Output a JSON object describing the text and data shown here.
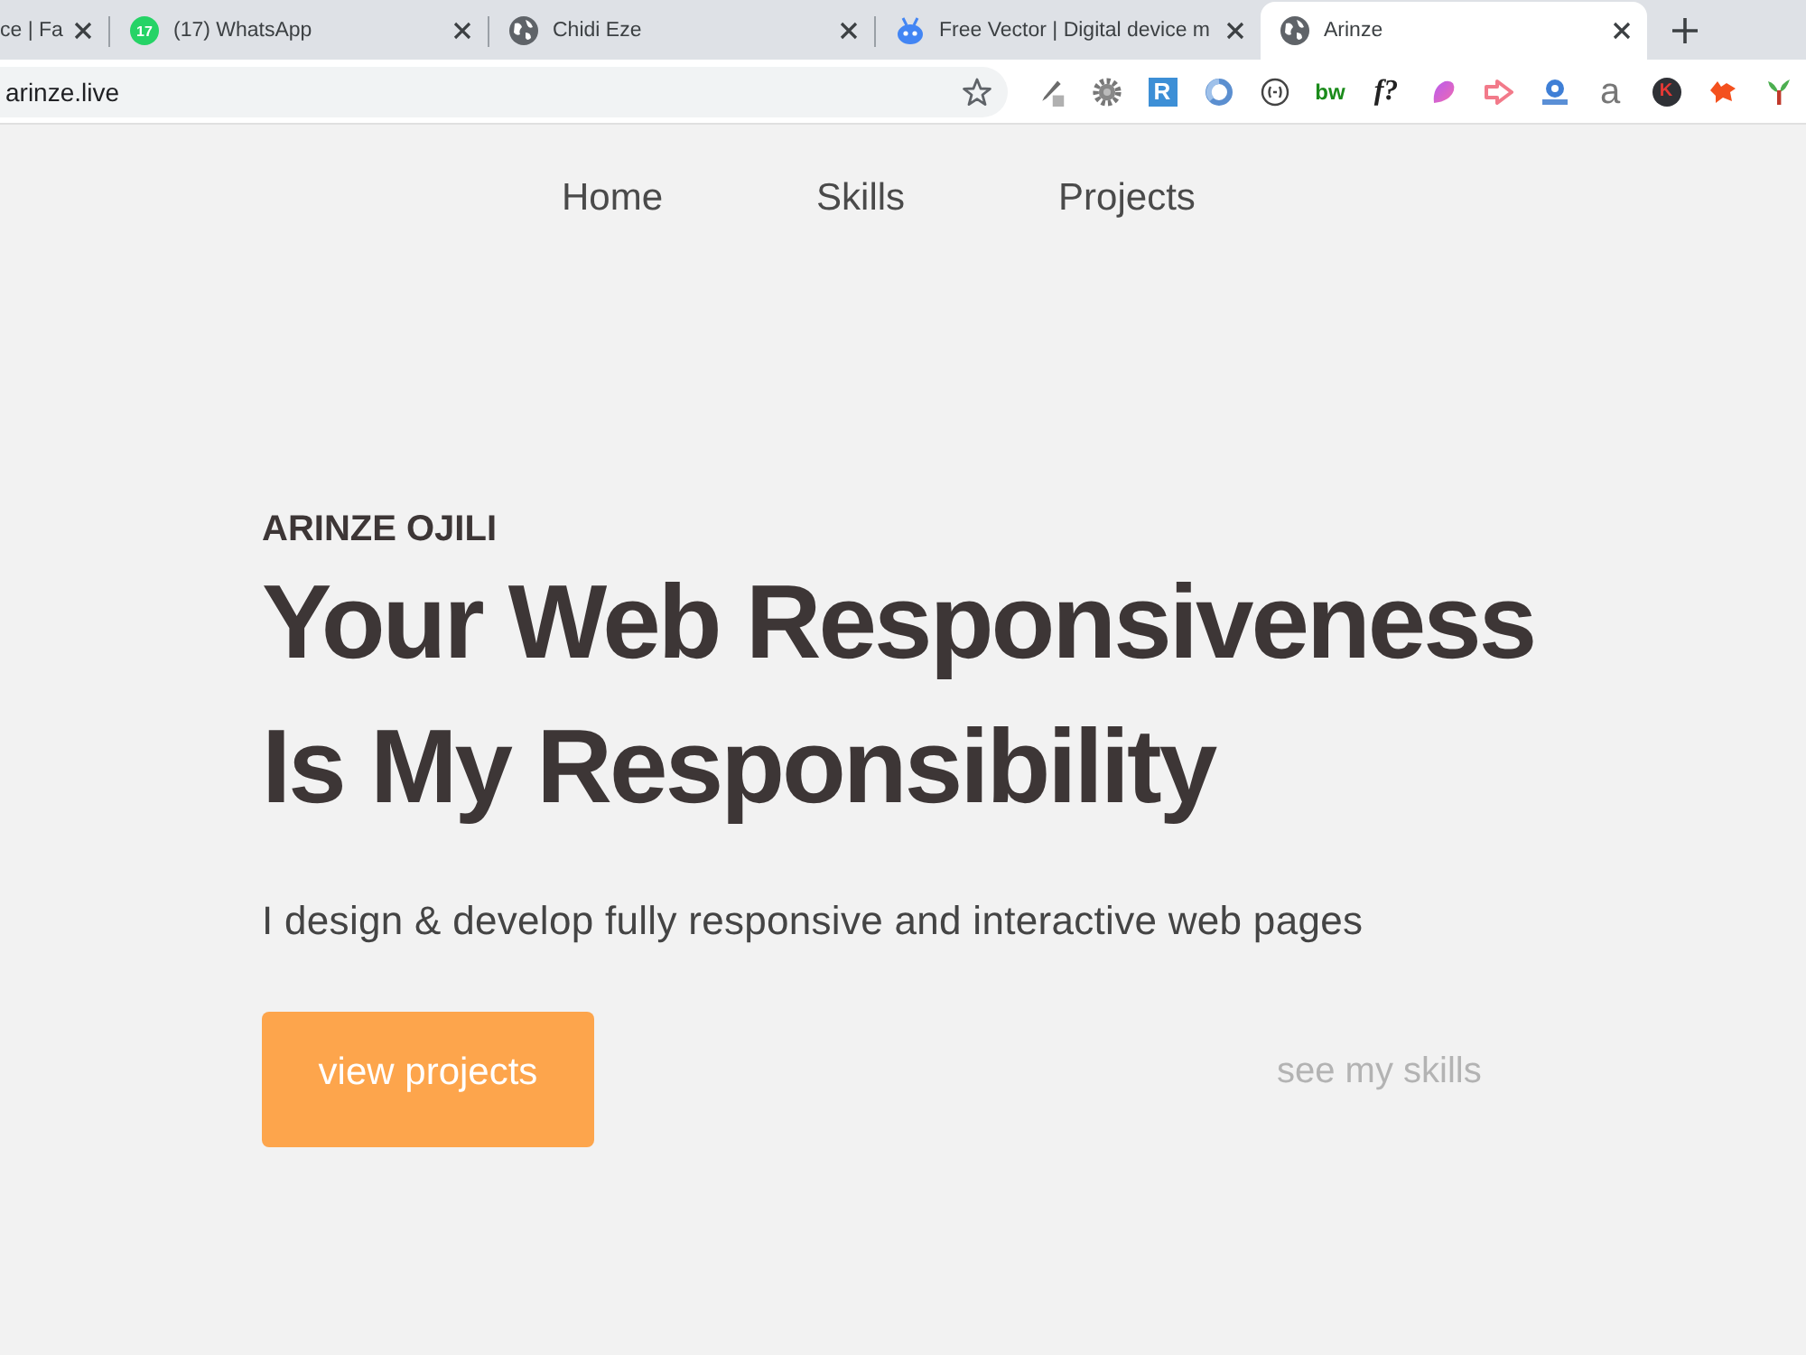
{
  "browser": {
    "tabs": [
      {
        "title": "ce | Fa",
        "selected": false
      },
      {
        "title": "(17) WhatsApp",
        "favicon": {
          "kind": "chat",
          "badge": "17"
        },
        "selected": false
      },
      {
        "title": "Chidi Eze",
        "favicon": {
          "kind": "globe"
        },
        "selected": false
      },
      {
        "title": "Free Vector | Digital device m",
        "favicon": {
          "kind": "robot"
        },
        "selected": false
      },
      {
        "title": "Arinze",
        "favicon": {
          "kind": "globe"
        },
        "selected": true
      }
    ],
    "address_bar": {
      "url": "arinze.live",
      "bookmarked": false
    },
    "extensions": [
      {
        "kind": "eyedropper"
      },
      {
        "kind": "gear"
      },
      {
        "kind": "tile",
        "label": "R"
      },
      {
        "kind": "ring"
      },
      {
        "kind": "brackets"
      },
      {
        "kind": "wordmark",
        "label": "bw"
      },
      {
        "kind": "formula",
        "label": "f?"
      },
      {
        "kind": "petal"
      },
      {
        "kind": "arrow"
      },
      {
        "kind": "badge"
      },
      {
        "kind": "letter",
        "label": "a"
      },
      {
        "kind": "disc",
        "label": "K"
      },
      {
        "kind": "burst"
      },
      {
        "kind": "plant"
      }
    ]
  },
  "page": {
    "nav": [
      {
        "label": "Home"
      },
      {
        "label": "Skills"
      },
      {
        "label": "Projects"
      }
    ],
    "eyebrow": "ARINZE OJILI",
    "headline": "Your Web Responsiveness Is My Responsibility",
    "tagline": "I design & develop fully responsive and interactive web pages",
    "primary_button": "view projects",
    "secondary_link": "see my skills"
  }
}
